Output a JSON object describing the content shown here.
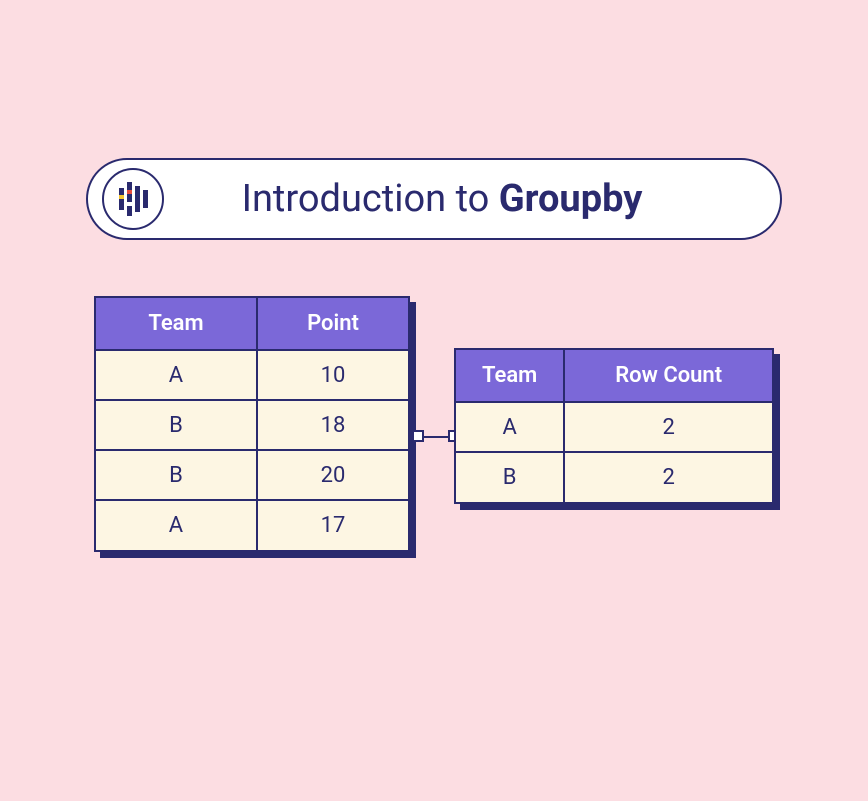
{
  "title": {
    "prefix": "Introduction to ",
    "bold": "Groupby"
  },
  "left_table": {
    "headers": [
      "Team",
      "Point"
    ],
    "rows": [
      [
        "A",
        "10"
      ],
      [
        "B",
        "18"
      ],
      [
        "B",
        "20"
      ],
      [
        "A",
        "17"
      ]
    ]
  },
  "right_table": {
    "headers": [
      "Team",
      "Row Count"
    ],
    "rows": [
      [
        "A",
        "2"
      ],
      [
        "B",
        "2"
      ]
    ]
  }
}
